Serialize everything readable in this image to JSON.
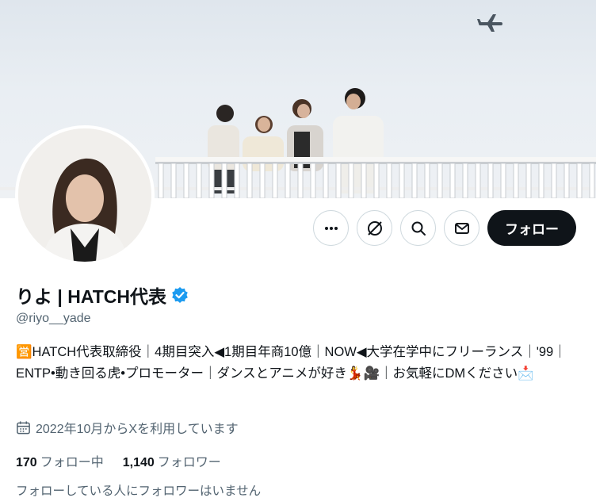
{
  "profile": {
    "display_name": "りよ | HATCH代表",
    "handle": "@riyo__yade",
    "verified_icon": "verified-badge-icon",
    "bio": "🈺HATCH代表取締役｜4期目突入◀︎1期目年商10億｜NOW◀︎大学在学中にフリーランス｜'99｜ENTP•動き回る虎•プロモーター｜ダンスとアニメが好き💃🎥｜お気軽にDMください📩",
    "joined": "2022年10月からXを利用しています",
    "following_count": "170",
    "following_label": "フォロー中",
    "followers_count": "1,140",
    "followers_label": "フォロワー",
    "mutual_note": "フォローしている人にフォロワーはいません"
  },
  "actions": {
    "more_icon": "more-icon",
    "grok_icon": "grok-icon",
    "search_icon": "search-icon",
    "message_icon": "mail-icon",
    "follow_label": "フォロー"
  },
  "colors": {
    "accent": "#1d9bf0",
    "text_primary": "#0f1419",
    "text_secondary": "#536471",
    "follow_bg": "#0f1419"
  }
}
